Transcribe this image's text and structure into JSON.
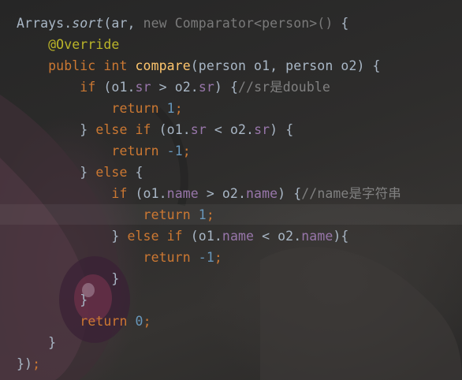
{
  "editor": {
    "lines": [
      {
        "tokens": [
          {
            "t": "Arrays.",
            "c": "plain"
          },
          {
            "t": "sort",
            "c": "plain italic"
          },
          {
            "t": "(ar, ",
            "c": "plain"
          },
          {
            "t": "new Comparator<person>() ",
            "c": "dim"
          },
          {
            "t": "{",
            "c": "plain"
          }
        ]
      },
      {
        "tokens": [
          {
            "t": "    ",
            "c": "plain"
          },
          {
            "t": "@Override",
            "c": "ann"
          }
        ]
      },
      {
        "tokens": [
          {
            "t": "    ",
            "c": "plain"
          },
          {
            "t": "public int ",
            "c": "kw"
          },
          {
            "t": "compare",
            "c": "fn"
          },
          {
            "t": "(person o1, person o2) {",
            "c": "plain"
          }
        ]
      },
      {
        "tokens": [
          {
            "t": "        ",
            "c": "plain"
          },
          {
            "t": "if ",
            "c": "kw"
          },
          {
            "t": "(o1.",
            "c": "plain"
          },
          {
            "t": "sr",
            "c": "field"
          },
          {
            "t": " > o2.",
            "c": "plain"
          },
          {
            "t": "sr",
            "c": "field"
          },
          {
            "t": ") {",
            "c": "plain"
          },
          {
            "t": "//sr是double",
            "c": "cmt"
          }
        ]
      },
      {
        "tokens": [
          {
            "t": "            ",
            "c": "plain"
          },
          {
            "t": "return ",
            "c": "kw"
          },
          {
            "t": "1",
            "c": "num"
          },
          {
            "t": ";",
            "c": "kw"
          }
        ]
      },
      {
        "tokens": [
          {
            "t": "        ",
            "c": "plain"
          },
          {
            "t": "} ",
            "c": "plain"
          },
          {
            "t": "else if ",
            "c": "kw"
          },
          {
            "t": "(o1.",
            "c": "plain"
          },
          {
            "t": "sr",
            "c": "field"
          },
          {
            "t": " < o2.",
            "c": "plain"
          },
          {
            "t": "sr",
            "c": "field"
          },
          {
            "t": ") {",
            "c": "plain"
          }
        ]
      },
      {
        "tokens": [
          {
            "t": "            ",
            "c": "plain"
          },
          {
            "t": "return ",
            "c": "kw"
          },
          {
            "t": "-1",
            "c": "num"
          },
          {
            "t": ";",
            "c": "kw"
          }
        ]
      },
      {
        "tokens": [
          {
            "t": "        ",
            "c": "plain"
          },
          {
            "t": "} ",
            "c": "plain"
          },
          {
            "t": "else ",
            "c": "kw"
          },
          {
            "t": "{",
            "c": "plain"
          }
        ]
      },
      {
        "tokens": [
          {
            "t": "            ",
            "c": "plain"
          },
          {
            "t": "if ",
            "c": "kw"
          },
          {
            "t": "(o1.",
            "c": "plain"
          },
          {
            "t": "name",
            "c": "field"
          },
          {
            "t": " > o2.",
            "c": "plain"
          },
          {
            "t": "name",
            "c": "field"
          },
          {
            "t": ") {",
            "c": "plain"
          },
          {
            "t": "//name是字符串",
            "c": "cmt"
          }
        ]
      },
      {
        "tokens": [
          {
            "t": "                ",
            "c": "plain"
          },
          {
            "t": "return ",
            "c": "kw"
          },
          {
            "t": "1",
            "c": "num"
          },
          {
            "t": ";",
            "c": "kw"
          }
        ]
      },
      {
        "tokens": [
          {
            "t": "            ",
            "c": "plain"
          },
          {
            "t": "} ",
            "c": "plain"
          },
          {
            "t": "else if ",
            "c": "kw"
          },
          {
            "t": "(o1.",
            "c": "plain"
          },
          {
            "t": "name",
            "c": "field"
          },
          {
            "t": " < o2.",
            "c": "plain"
          },
          {
            "t": "name",
            "c": "field"
          },
          {
            "t": "){",
            "c": "plain"
          }
        ]
      },
      {
        "tokens": [
          {
            "t": "                ",
            "c": "plain"
          },
          {
            "t": "return ",
            "c": "kw"
          },
          {
            "t": "-1",
            "c": "num"
          },
          {
            "t": ";",
            "c": "kw"
          }
        ]
      },
      {
        "tokens": [
          {
            "t": "            ",
            "c": "plain"
          },
          {
            "t": "}",
            "c": "plain"
          }
        ]
      },
      {
        "tokens": [
          {
            "t": "        ",
            "c": "plain"
          },
          {
            "t": "}",
            "c": "plain"
          }
        ]
      },
      {
        "tokens": [
          {
            "t": "        ",
            "c": "plain"
          },
          {
            "t": "return ",
            "c": "kw"
          },
          {
            "t": "0",
            "c": "num"
          },
          {
            "t": ";",
            "c": "kw"
          }
        ]
      },
      {
        "tokens": [
          {
            "t": "    ",
            "c": "plain"
          },
          {
            "t": "}",
            "c": "plain"
          }
        ]
      },
      {
        "tokens": [
          {
            "t": "})",
            "c": "plain"
          },
          {
            "t": ";",
            "c": "kw"
          }
        ]
      }
    ]
  },
  "colors": {
    "background": "#2b2b2b",
    "plain": "#a9b7c6",
    "keyword": "#cc7832",
    "number": "#6897bb",
    "annotation": "#bbb529",
    "function": "#ffc66d",
    "field": "#9876aa",
    "comment": "#808080"
  }
}
